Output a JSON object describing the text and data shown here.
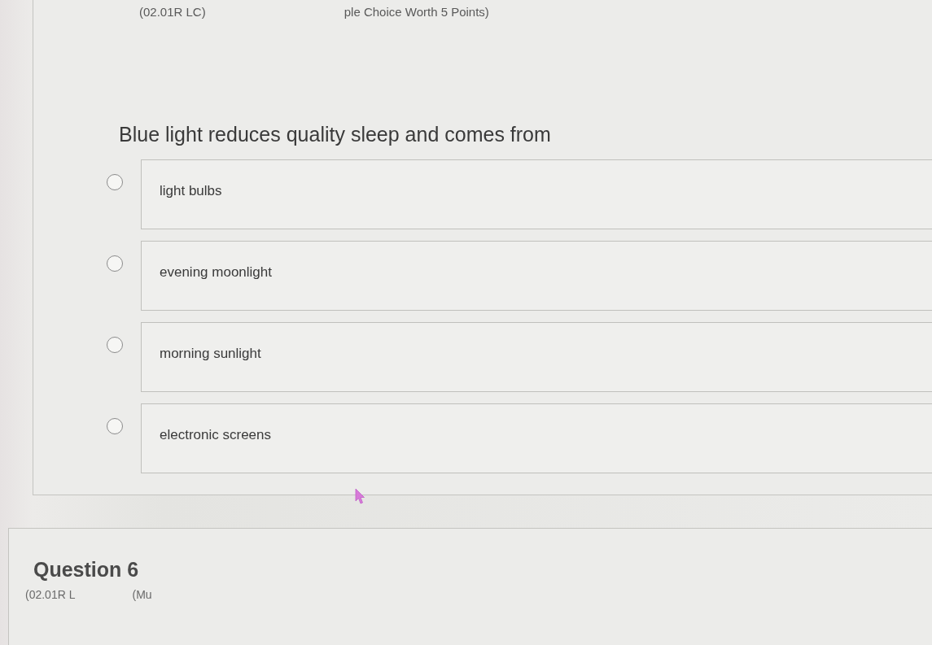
{
  "question_card": {
    "code": "(02.01R LC)",
    "worth": "ple Choice Worth 5 Points)",
    "prompt": "Blue light reduces quality sleep and comes from",
    "options": [
      {
        "label": "light bulbs",
        "selected": false
      },
      {
        "label": "evening moonlight",
        "selected": false
      },
      {
        "label": "morning sunlight",
        "selected": false
      },
      {
        "label": "electronic screens",
        "selected": false
      }
    ]
  },
  "next_card": {
    "title": "Question 6",
    "code": "(02.01R L",
    "worth": "(Mu"
  }
}
